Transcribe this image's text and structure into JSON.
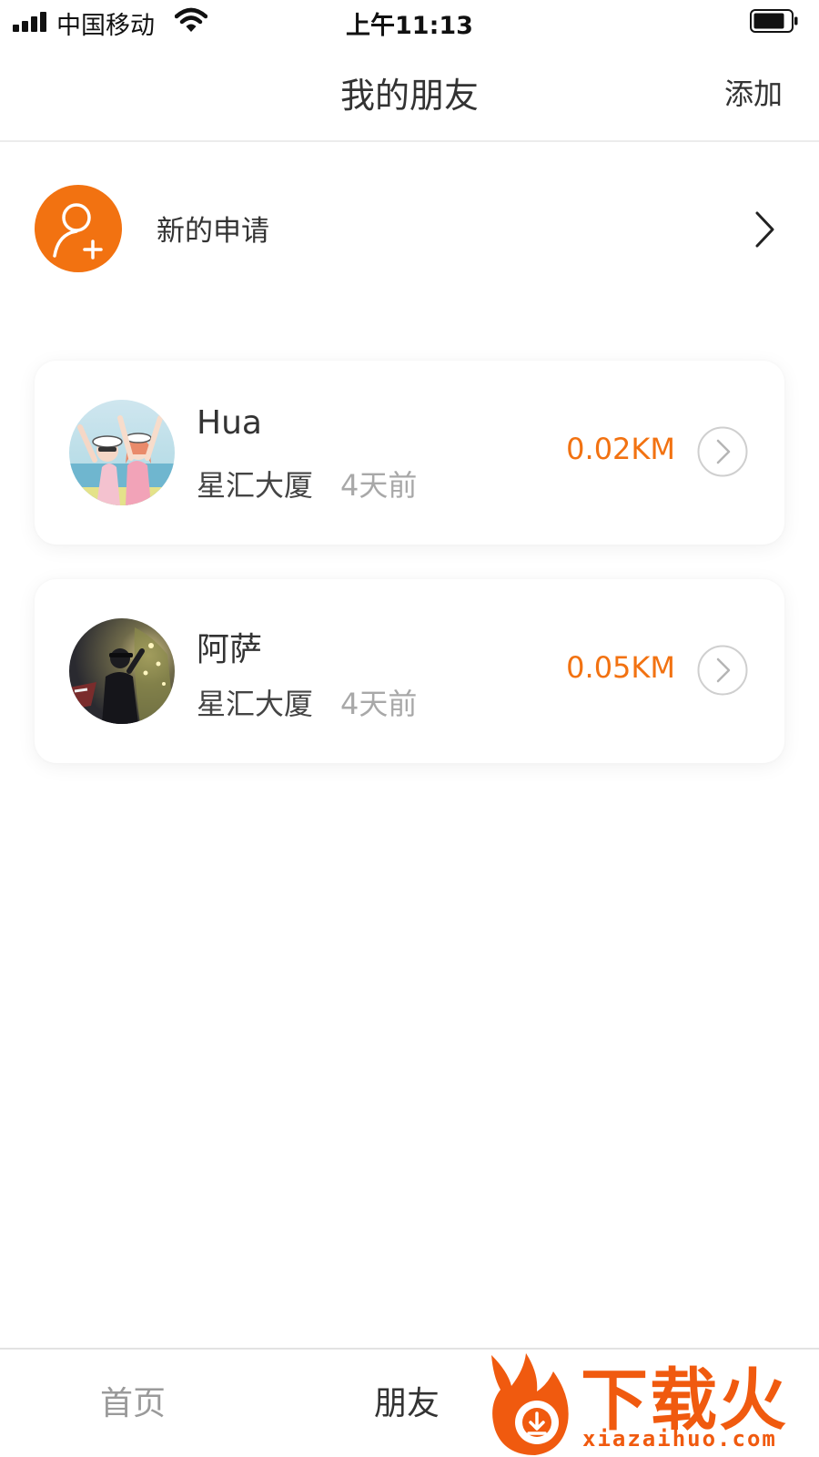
{
  "status_bar": {
    "carrier": "中国移动",
    "time": "上午11:13"
  },
  "nav": {
    "title": "我的朋友",
    "add_label": "添加"
  },
  "new_request": {
    "label": "新的申请",
    "icon": "add-user-icon"
  },
  "friends": [
    {
      "name": "Hua",
      "location": "星汇大厦",
      "time_ago": "4天前",
      "distance": "0.02KM"
    },
    {
      "name": "阿萨",
      "location": "星汇大厦",
      "time_ago": "4天前",
      "distance": "0.05KM"
    }
  ],
  "tab_bar": {
    "tabs": [
      {
        "label": "首页",
        "active": false
      },
      {
        "label": "朋友",
        "active": true
      }
    ]
  },
  "watermark": {
    "text": "下载火",
    "url": "xiazaihuo.com"
  },
  "colors": {
    "accent": "#f27211",
    "text_primary": "#333333",
    "text_muted": "#a8a8a8",
    "tab_inactive": "#9a9a9a",
    "watermark": "#f05a0f"
  }
}
